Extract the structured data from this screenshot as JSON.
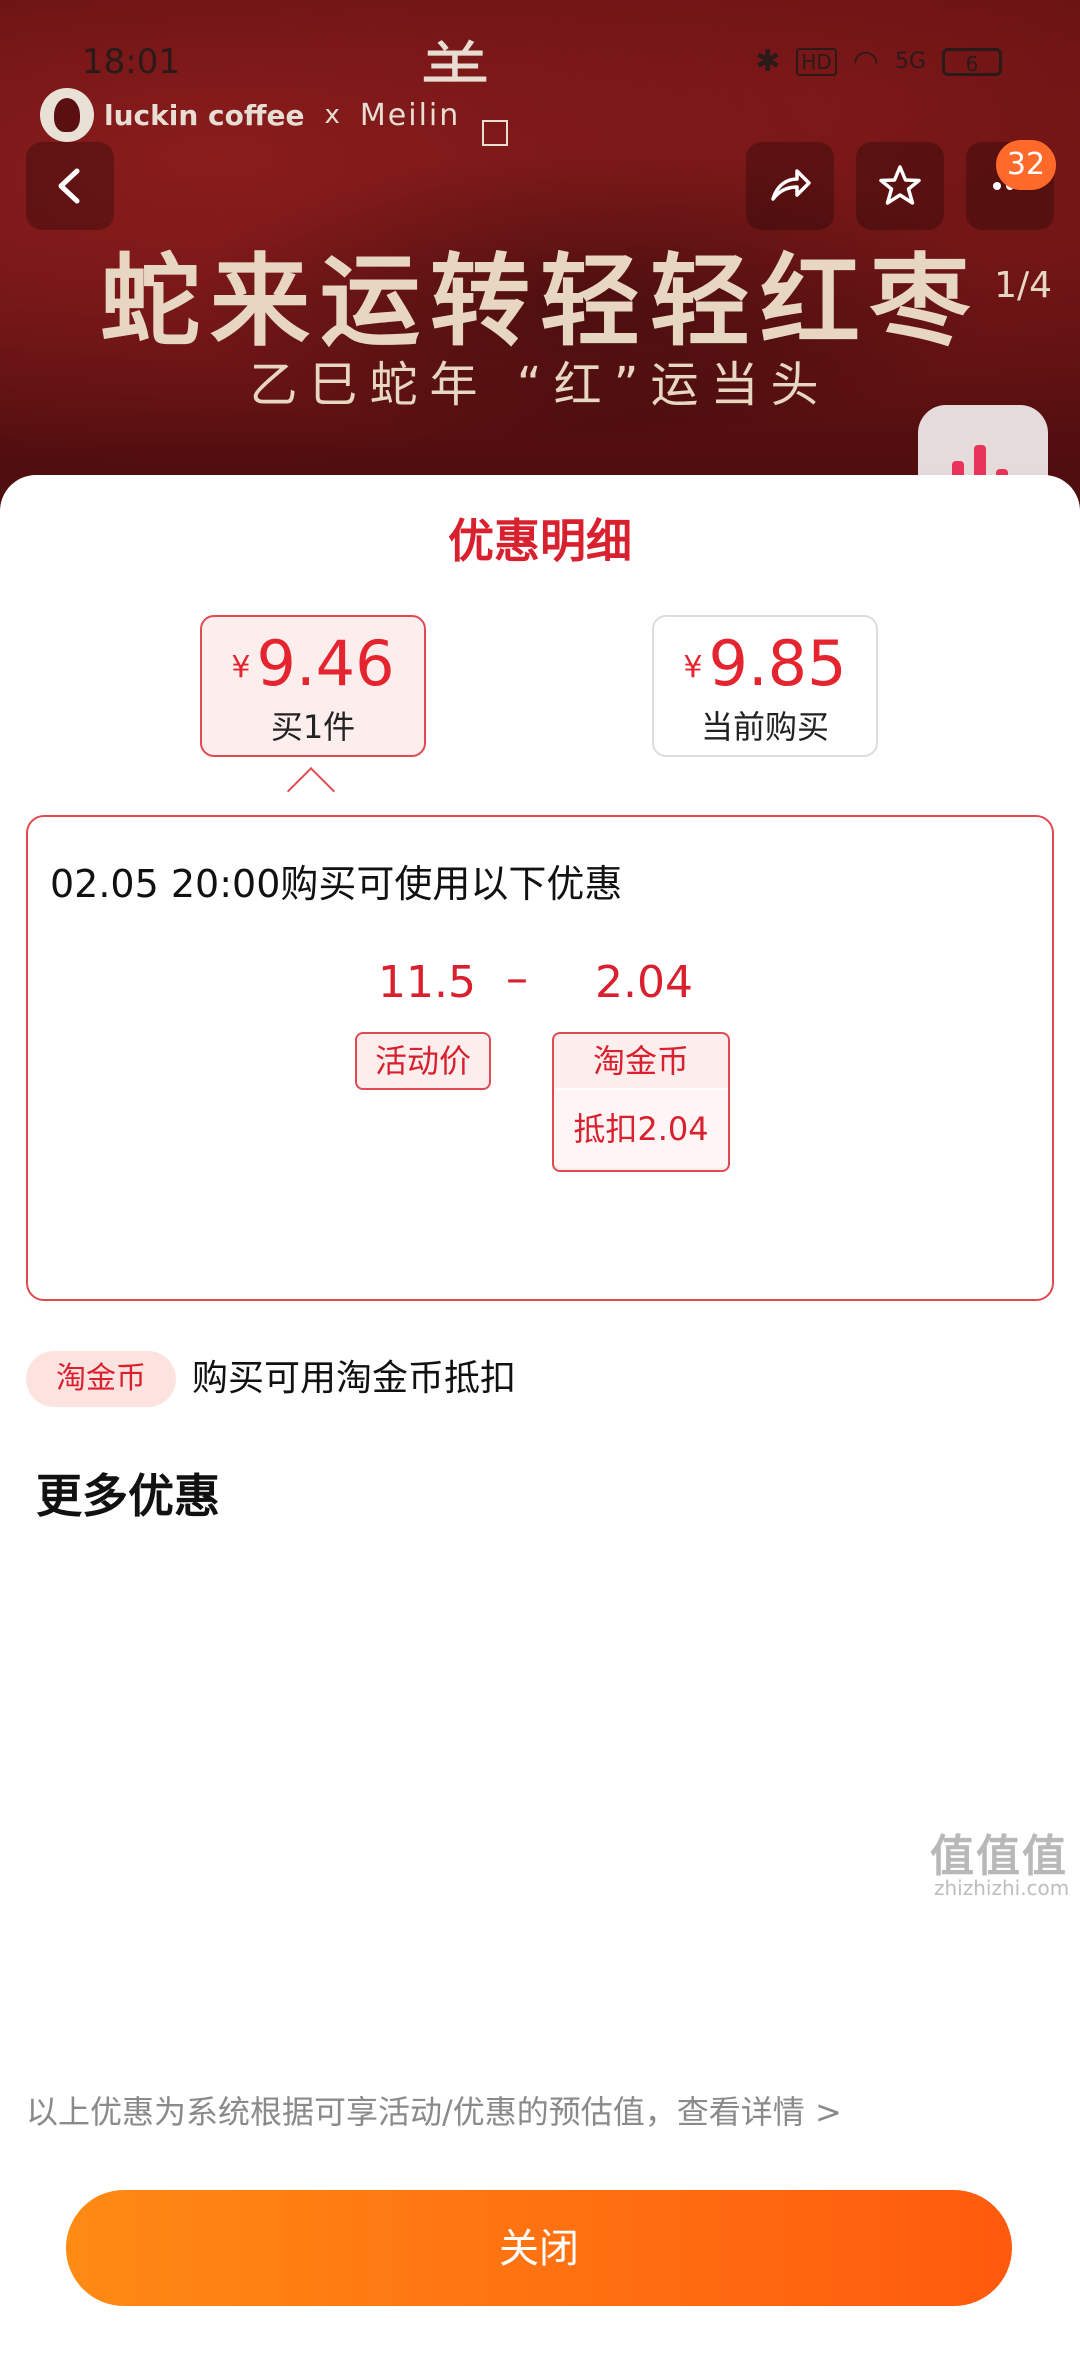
{
  "status_bar": {
    "time": "18:01",
    "hd": "HD",
    "signal": "5G",
    "battery": "6"
  },
  "banner": {
    "brand_primary": "luckin coffee",
    "brand_x": "x",
    "brand_partner": "Meilin",
    "headline": "蛇来运转轻轻红枣",
    "subline": "乙巳蛇年 “红”运当头",
    "cart_badge": "32",
    "page_indicator": "1/4"
  },
  "sheet": {
    "title": "优惠明细",
    "price_options": [
      {
        "currency": "¥",
        "amount": "9.46",
        "label": "买1件",
        "selected": true
      },
      {
        "currency": "¥",
        "amount": "9.85",
        "label": "当前购买",
        "selected": false
      }
    ],
    "detail": {
      "heading": "02.05 20:00购买可使用以下优惠",
      "base_price": "11.5",
      "operator": "–",
      "deduction": "2.04",
      "base_tag": "活动价",
      "deduction_tag": "淘金币",
      "deduction_note": "抵扣2.04"
    },
    "coin_tag": "淘金币",
    "coin_desc": "购买可用淘金币抵扣",
    "more_title": "更多优惠",
    "footnote": "以上优惠为系统根据可享活动/优惠的预估值，查看详情 >",
    "close_label": "关闭"
  },
  "watermark": {
    "main": "值值值",
    "sub": "zhizhizhi.com"
  },
  "colors": {
    "accent_red": "#d9202e",
    "button_orange": "#ff6a10",
    "banner_red": "#6e1516"
  },
  "icons": [
    "back-icon",
    "share-icon",
    "star-icon",
    "more-icon",
    "chart-icon"
  ]
}
